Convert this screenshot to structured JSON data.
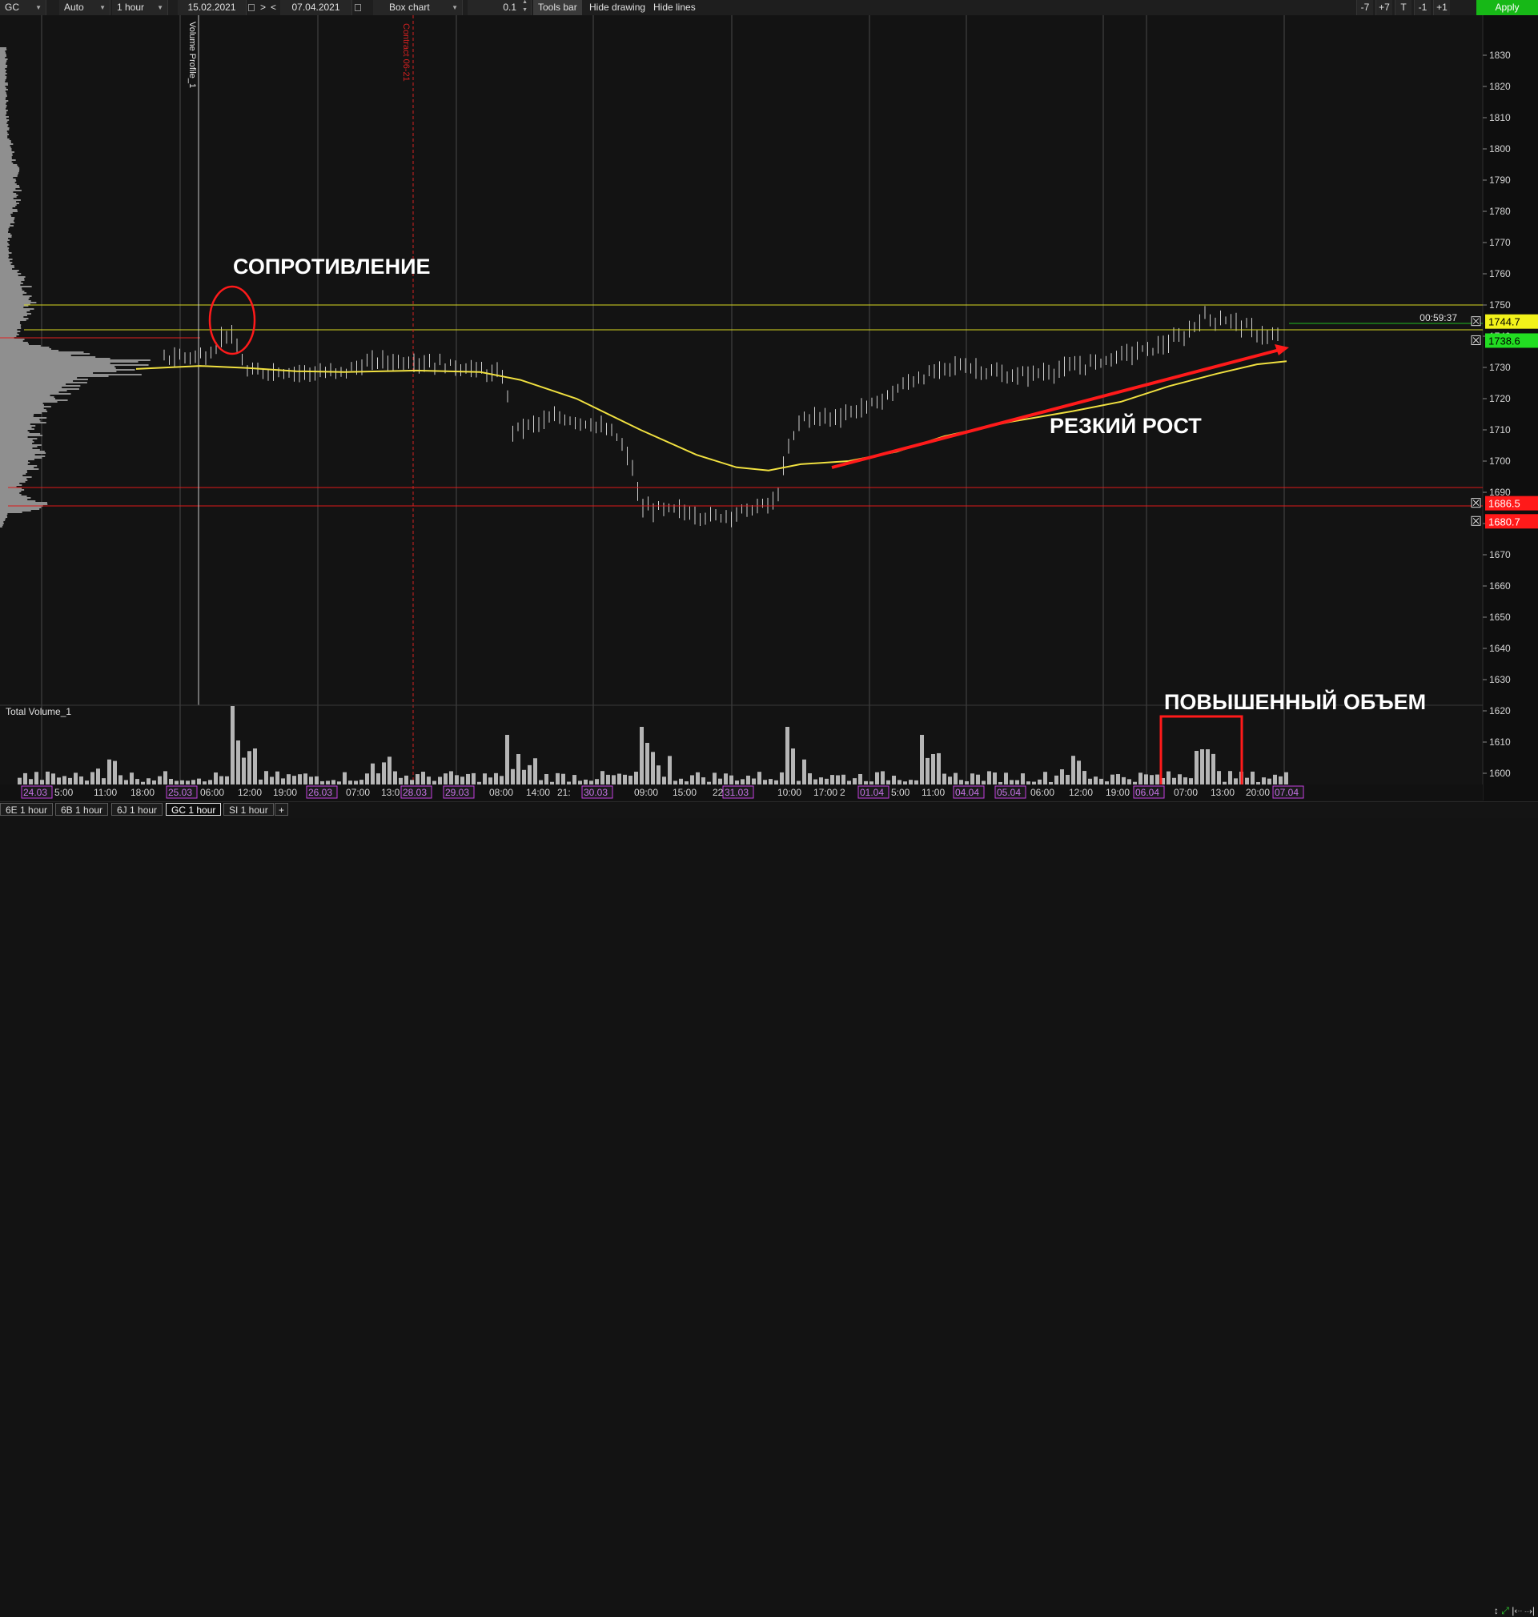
{
  "toolbar": {
    "symbol": "GC",
    "scale_mode": "Auto",
    "timeframe": "1 hour",
    "date_from": "15.02.2021",
    "nav_prev": "<",
    "nav_next": ">",
    "date_to": "07.04.2021",
    "chart_type": "Box chart",
    "step": "0.1",
    "tools_bar": "Tools bar",
    "hide_drawing": "Hide drawing",
    "hide_lines": "Hide lines",
    "btn_minus7": "-7",
    "btn_plus7": "+7",
    "btn_t": "T",
    "btn_minus1": "-1",
    "btn_plus1": "+1",
    "apply": "Apply"
  },
  "price_axis": {
    "ticks": [
      "1830",
      "1820",
      "1810",
      "1800",
      "1790",
      "1780",
      "1770",
      "1760",
      "1750",
      "1740",
      "1730",
      "1720",
      "1710",
      "1700",
      "1690",
      "1680",
      "1670",
      "1660",
      "1650",
      "1640",
      "1630",
      "1620",
      "1610",
      "1600"
    ]
  },
  "price_levels": [
    {
      "value": "1744.7",
      "color": "#f2f21a",
      "text_color": "#000000"
    },
    {
      "value": "1738.6",
      "color": "#22dd22",
      "text_color": "#000000"
    },
    {
      "value": "1686.5",
      "color": "#ff1a1a",
      "text_color": "#ffffff"
    },
    {
      "value": "1680.7",
      "color": "#ff1a1a",
      "text_color": "#ffffff"
    }
  ],
  "timer": "00:59:37",
  "vertical_labels": {
    "volume_profile": "Volume Profile_1",
    "contract": "Contract 06-21"
  },
  "annotations": {
    "resistance": "СОПРОТИВЛЕНИЕ",
    "sharp_rise": "РЕЗКИЙ РОСТ",
    "high_volume": "ПОВЫШЕННЫЙ ОБЪЕМ"
  },
  "volume_panel": {
    "title": "Total Volume_1"
  },
  "time_axis": {
    "labels": [
      "24.03",
      "5:00",
      "11:00",
      "18:00",
      "25.03",
      "06:00",
      "12:00",
      "19:00",
      "26.03",
      "07:00",
      "13:0",
      "28.03",
      "29.03",
      "08:00",
      "14:00",
      "21:",
      "30.03",
      "09:00",
      "15:00",
      "22:",
      "31.03",
      "10:00",
      "17:00",
      "2",
      "01.04",
      "5:00",
      "11:00",
      "04.04",
      "05.04",
      "06:00",
      "12:00",
      "19:00",
      "06.04",
      "07:00",
      "13:00",
      "20:00",
      "07.04"
    ],
    "date_highlight_color": "#c43fe0"
  },
  "tabs": [
    "6E 1 hour",
    "6B 1 hour",
    "6J 1 hour",
    "GC 1 hour",
    "SI 1 hour",
    "+"
  ],
  "active_tab": "GC 1 hour",
  "colors": {
    "background": "#131313",
    "ma_line": "#f0e040",
    "annotation_red": "#ff1a1a",
    "profile": "#9a9a9a"
  }
}
